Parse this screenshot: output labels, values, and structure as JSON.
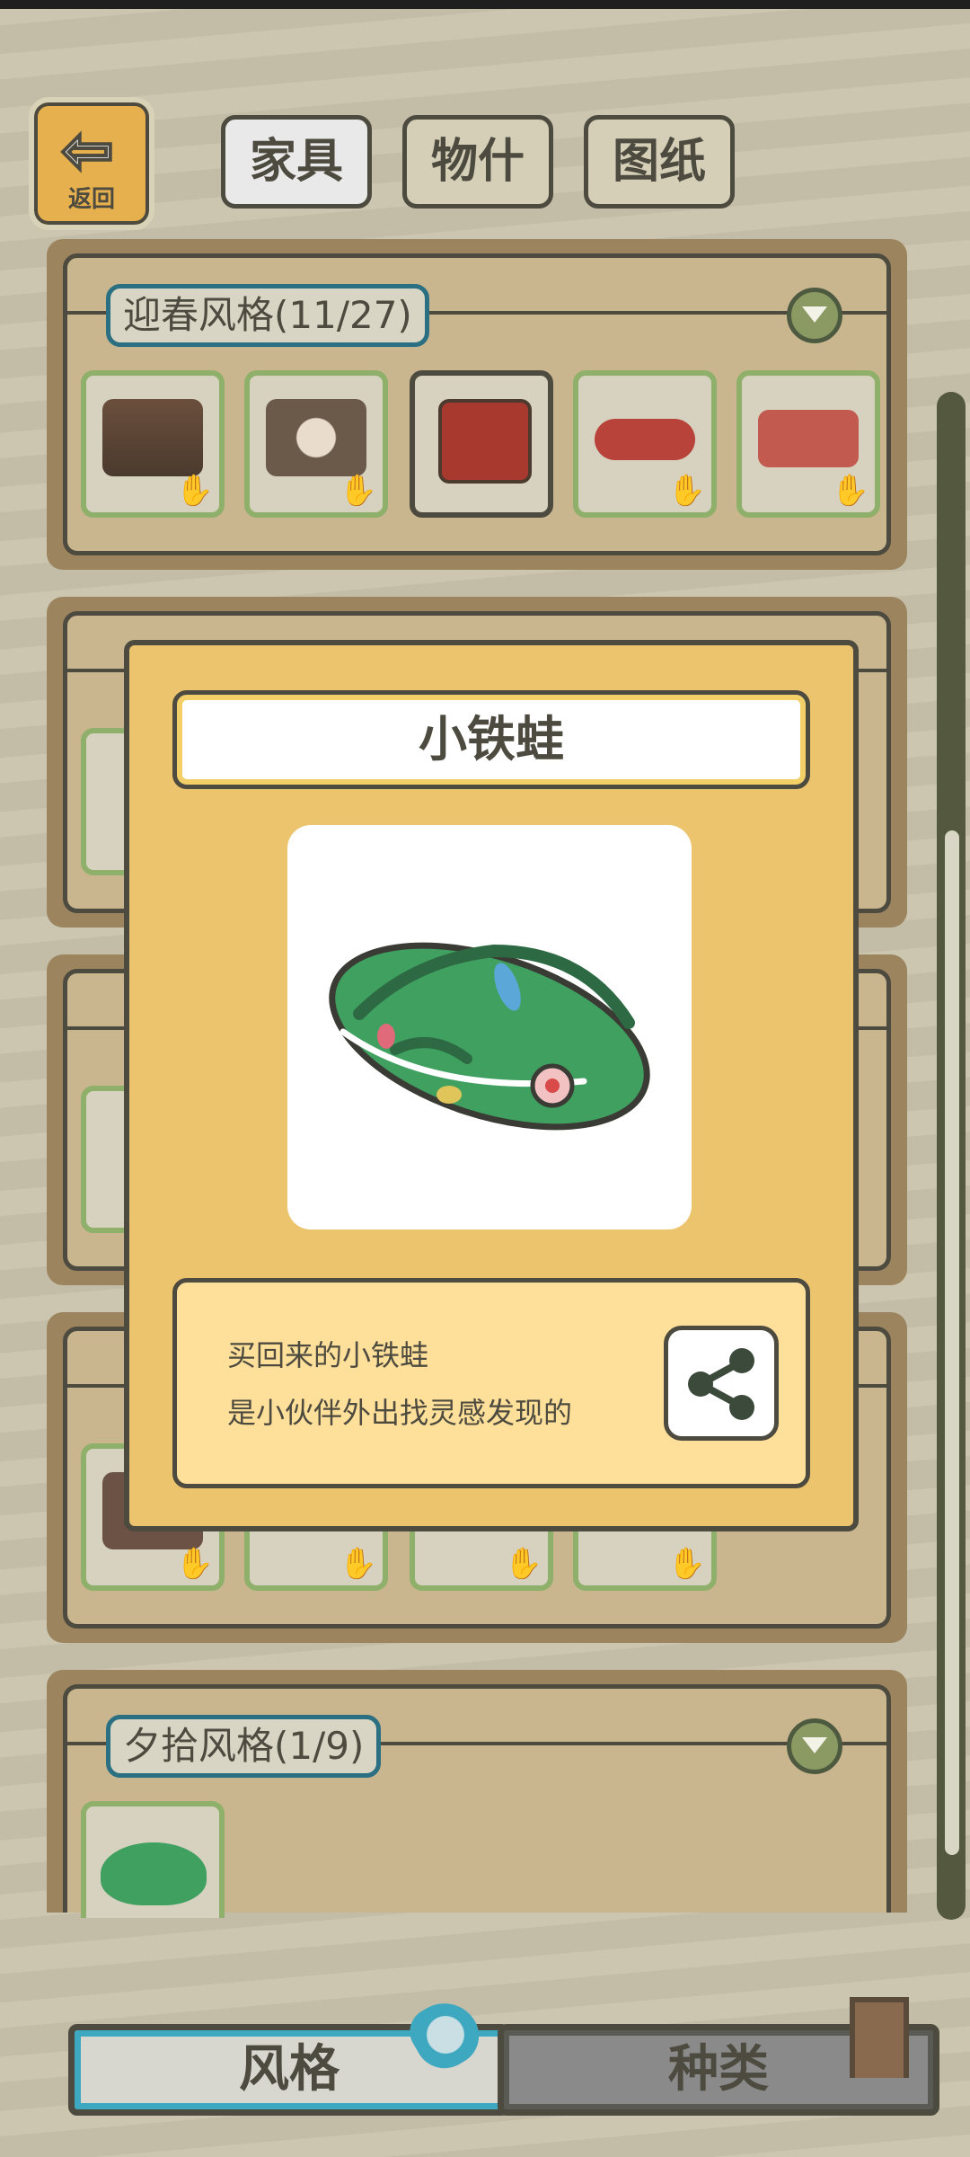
{
  "header": {
    "back_label": "返回",
    "tabs": [
      {
        "label": "家具",
        "active": true
      },
      {
        "label": "物什",
        "active": false
      },
      {
        "label": "图纸",
        "active": false
      }
    ]
  },
  "sections": [
    {
      "title": "迎春风格(11/27)"
    },
    {
      "title": "夕拾风格(1/9)"
    }
  ],
  "dialog": {
    "title": "小铁蛙",
    "description_line1": "买回来的小铁蛙",
    "description_line2": "是小伙伴外出找灵感发现的"
  },
  "bottom_tabs": [
    {
      "label": "风格",
      "active": true
    },
    {
      "label": "种类",
      "active": false
    }
  ],
  "colors": {
    "panel_border": "#9c855e",
    "dialog_bg": "#ecc46e",
    "frog_green": "#3fa060",
    "item_border_green": "#8fb06a"
  }
}
